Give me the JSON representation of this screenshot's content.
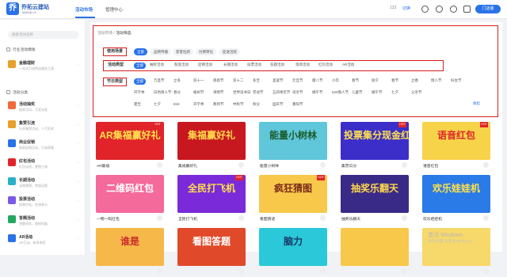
{
  "header": {
    "logo_mark": "乔",
    "brand_name": "乔拓云建站",
    "brand_domain": "qiaoqi.cn",
    "nav": [
      {
        "label": "活动市场",
        "active": true
      },
      {
        "label": "管理中心",
        "active": false
      }
    ],
    "right_items": [
      "123",
      "切换"
    ],
    "upgrade_button": "门店版",
    "accent_color": "#2a72e8"
  },
  "sidebar": {
    "search_placeholder": "搜索活动名称",
    "sections": [
      {
        "label": "行业活动模板"
      },
      {
        "label": "活动分类"
      }
    ],
    "featured": {
      "title": "金融理财",
      "desc": "一站式引流到店服务工具"
    },
    "items": [
      {
        "title": "活动抽奖",
        "desc": "抽奖活动，大奖派发",
        "color": "#f06a3a"
      },
      {
        "title": "集赞引流",
        "desc": "分享集赞活动，人气狂欢",
        "color": "#e7a02a"
      },
      {
        "title": "商业促销",
        "desc": "商家促销活动，引流获客",
        "color": "#2a72e8"
      },
      {
        "title": "红包活动",
        "desc": "红包派送，营销工具",
        "color": "#e0242a"
      },
      {
        "title": "长期活动",
        "desc": "长期营销，常态运营",
        "color": "#2ab0c8"
      },
      {
        "title": "投票活动",
        "desc": "投票评选，在线参与",
        "color": "#7a5ae8"
      },
      {
        "title": "答题活动",
        "desc": "答题闯关，吸粉利器",
        "color": "#23a861"
      },
      {
        "title": "AR活动",
        "desc": "AR互动，新奇体验",
        "color": "#2a72e8"
      }
    ]
  },
  "main": {
    "breadcrumb": {
      "root": "活动市场",
      "current": "活动筛选"
    },
    "filters": {
      "usage_label": "使用场景",
      "usage_chips": [
        {
          "label": "全部",
          "on": true
        },
        {
          "label": "品牌传播",
          "on": false
        },
        {
          "label": "获客拉新",
          "on": false
        },
        {
          "label": "付费转化",
          "on": false
        },
        {
          "label": "促进活跃",
          "on": false
        }
      ],
      "type_label": "活动类型",
      "type_tags": [
        {
          "label": "全部",
          "on": true
        },
        {
          "label": "抽奖活动",
          "on": false
        },
        {
          "label": "裂变活动",
          "on": false
        },
        {
          "label": "促销活动",
          "on": false
        },
        {
          "label": "长期活动",
          "on": false
        },
        {
          "label": "投票活动",
          "on": false
        },
        {
          "label": "答题活动",
          "on": false
        },
        {
          "label": "现场活动",
          "on": false
        },
        {
          "label": "红包活动",
          "on": false
        },
        {
          "label": "AR活动",
          "on": false
        }
      ],
      "holiday_label": "节日类型",
      "holiday_tags": [
        [
          "全部",
          "万圣节",
          "立冬",
          "双十一",
          "感恩节",
          "双十二",
          "冬至",
          "圣诞节",
          "元旦节",
          "腊八节",
          "小年",
          "春节",
          "除夕",
          "春节",
          "立春",
          "情人节",
          "妇女节"
        ],
        [
          "开学季",
          "白色情人节",
          "春分",
          "植树节",
          "清明节",
          "世界读书日",
          "劳动节",
          "五四青年节",
          "母亲节",
          "端午节",
          "520情人节",
          "儿童节",
          "端午节",
          "七夕",
          "父亲节"
        ],
        [
          "夏至",
          "七夕",
          "818",
          "开学季",
          "教师节",
          "中秋节",
          "秋分",
          "国庆节",
          "重阳节"
        ]
      ],
      "more_label": "收起"
    },
    "cards": [
      {
        "title": "AR集福赢好礼",
        "name": "AR集福",
        "bg": "#e0242a",
        "fg": "#ffe14a",
        "hot": true
      },
      {
        "title": "集福赢好礼",
        "name": "集福赢好礼",
        "bg": "#c8181f",
        "fg": "#ffd84a",
        "hot": false
      },
      {
        "title": "能量小树林",
        "name": "能量小树林",
        "bg": "#5fc7d9",
        "fg": "#1a5c2e",
        "hot": false
      },
      {
        "title": "投票集分现金红包",
        "name": "集赞瓜分",
        "bg": "#3b2ec9",
        "fg": "#ffe14a",
        "hot": true
      },
      {
        "title": "语音红包",
        "name": "语音红包",
        "bg": "#f7d34a",
        "fg": "#e0242a",
        "hot": true
      },
      {
        "title": "二维码红包",
        "name": "一物一码红包",
        "bg": "#f46a9a",
        "fg": "#ffffff",
        "hot": false
      },
      {
        "title": "全民打飞机",
        "name": "全民打飞机",
        "bg": "#7a2ad8",
        "fg": "#ffe14a",
        "hot": true
      },
      {
        "title": "疯狂猜图",
        "name": "看图猜谜",
        "bg": "#f7c84a",
        "fg": "#7a2a1a",
        "hot": true
      },
      {
        "title": "抽奖乐翻天",
        "name": "抽奖乐翻天",
        "bg": "#3a2a88",
        "fg": "#ffd84a",
        "hot": false
      },
      {
        "title": "欢乐娃娃机",
        "name": "欢乐娃娃机",
        "bg": "#2a7ae8",
        "fg": "#ffe14a",
        "hot": false
      },
      {
        "title": "谁是",
        "name": "",
        "bg": "#f7b84a",
        "fg": "#c82a2a",
        "hot": false
      },
      {
        "title": "看图答题",
        "name": "",
        "bg": "#e04a2a",
        "fg": "#ffffff",
        "hot": false
      },
      {
        "title": "脑力",
        "name": "",
        "bg": "#2ac8d8",
        "fg": "#1a3a6a",
        "hot": false
      },
      {
        "title": "",
        "name": "",
        "bg": "#f7c84a",
        "fg": "#c82a2a",
        "hot": false
      },
      {
        "title": "",
        "name": "",
        "bg": "#f7d86a",
        "fg": "#c82a2a",
        "hot": false
      }
    ]
  },
  "overlay": {
    "watermark": "激活 Windows",
    "watermark_sub": "转到\"设置\"以激活 Windows。"
  }
}
